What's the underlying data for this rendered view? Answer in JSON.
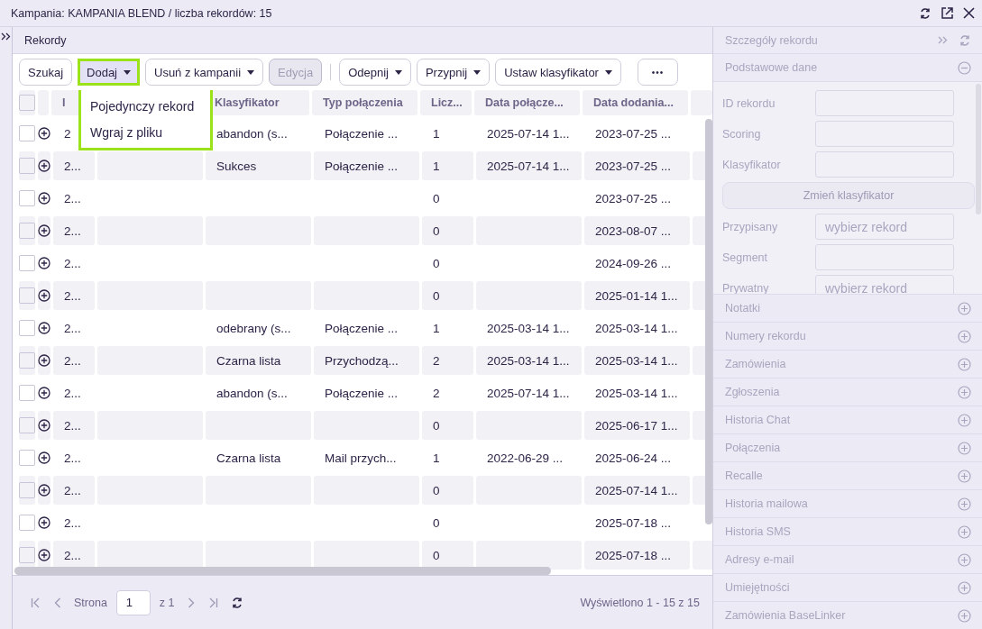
{
  "window": {
    "title": "Kampania: KAMPANIA BLEND / liczba rekordów: 15"
  },
  "panel_title": "Rekordy",
  "toolbar": [
    {
      "kind": "button",
      "label": "Szukaj",
      "dropdown": false,
      "disabled": false,
      "selected": false
    },
    {
      "kind": "button",
      "label": "Dodaj",
      "dropdown": true,
      "disabled": false,
      "selected": true
    },
    {
      "kind": "button",
      "label": "Usuń z kampanii",
      "dropdown": true,
      "disabled": false,
      "selected": false
    },
    {
      "kind": "button",
      "label": "Edycja",
      "dropdown": false,
      "disabled": true,
      "selected": false
    },
    {
      "kind": "separator"
    },
    {
      "kind": "button",
      "label": "Odepnij",
      "dropdown": true,
      "disabled": false,
      "selected": false
    },
    {
      "kind": "button",
      "label": "Przypnij",
      "dropdown": true,
      "disabled": false,
      "selected": false
    },
    {
      "kind": "button",
      "label": "Ustaw klasyfikator",
      "dropdown": true,
      "disabled": false,
      "selected": false
    },
    {
      "kind": "more",
      "label": "•••"
    }
  ],
  "dropdown_menu": [
    "Pojedynczy rekord",
    "Wgraj z pliku"
  ],
  "table": {
    "header_checked": false,
    "columns": [
      "I",
      null,
      "Klasyfikator",
      "Typ połączenia",
      "Licz...",
      "Data połącze...",
      "Data dodania...",
      null
    ],
    "rows": [
      {
        "checked": false,
        "cells": [
          "2",
          null,
          "abandon (s...",
          "Połączenie ...",
          "1",
          "2025-07-14 1...",
          "2023-07-25 ...",
          null
        ]
      },
      {
        "checked": false,
        "cells": [
          "2...",
          null,
          "Sukces",
          "Połączenie ...",
          "1",
          "2025-07-14 1...",
          "2023-07-25 ...",
          null
        ]
      },
      {
        "checked": false,
        "cells": [
          "2...",
          null,
          null,
          null,
          "0",
          null,
          "2023-07-25 ...",
          null
        ]
      },
      {
        "checked": false,
        "cells": [
          "2...",
          null,
          null,
          null,
          "0",
          null,
          "2023-08-07 ...",
          null
        ]
      },
      {
        "checked": false,
        "cells": [
          "2...",
          null,
          null,
          null,
          "0",
          null,
          "2024-09-26 ...",
          null
        ]
      },
      {
        "checked": false,
        "cells": [
          "2...",
          null,
          null,
          null,
          "0",
          null,
          "2025-01-14 1...",
          null
        ]
      },
      {
        "checked": false,
        "cells": [
          "2...",
          null,
          "odebrany (s...",
          "Połączenie ...",
          "1",
          "2025-03-14 1...",
          "2025-03-14 1...",
          null
        ]
      },
      {
        "checked": false,
        "cells": [
          "2...",
          null,
          "Czarna lista",
          "Przychodzą...",
          "2",
          "2025-03-14 1...",
          "2025-03-14 1...",
          null
        ]
      },
      {
        "checked": false,
        "cells": [
          "2...",
          null,
          "abandon (s...",
          "Połączenie ...",
          "2",
          "2025-07-14 1...",
          "2025-03-14 1...",
          null
        ]
      },
      {
        "checked": false,
        "cells": [
          "2...",
          null,
          null,
          null,
          "0",
          null,
          "2025-06-17 1...",
          null
        ]
      },
      {
        "checked": false,
        "cells": [
          "2...",
          null,
          "Czarna lista",
          "Mail przych...",
          "1",
          "2022-06-29 ...",
          "2025-06-24 ...",
          null
        ]
      },
      {
        "checked": false,
        "cells": [
          "2...",
          null,
          null,
          null,
          "0",
          null,
          "2025-07-14 1...",
          null
        ]
      },
      {
        "checked": false,
        "cells": [
          "2...",
          null,
          null,
          null,
          "0",
          null,
          "2025-07-18 ...",
          null
        ]
      },
      {
        "checked": false,
        "cells": [
          "2...",
          null,
          null,
          null,
          "0",
          null,
          "2025-07-18 ...",
          null
        ]
      }
    ]
  },
  "pagination": {
    "page_label": "Strona",
    "page": "1",
    "of": "z 1",
    "summary": "Wyświetlono 1 - 15 z 15"
  },
  "details": {
    "title": "Szczegóły rekordu",
    "sections": [
      {
        "title": "Podstawowe dane",
        "expanded": true,
        "fields": [
          {
            "kind": "input",
            "label": "ID rekordu"
          },
          {
            "kind": "input",
            "label": "Scoring"
          },
          {
            "kind": "input",
            "label": "Klasyfikator"
          },
          {
            "kind": "button",
            "label": "Zmień klasyfikator"
          },
          {
            "kind": "input",
            "label": "Przypisany",
            "placeholder": "wybierz rekord"
          },
          {
            "kind": "input",
            "label": "Segment"
          },
          {
            "kind": "input",
            "label": "Prywatny",
            "placeholder": "wybierz rekord"
          }
        ]
      },
      {
        "title": "Notatki",
        "expanded": false
      },
      {
        "title": "Numery rekordu",
        "expanded": false
      },
      {
        "title": "Zamówienia",
        "expanded": false
      },
      {
        "title": "Zgłoszenia",
        "expanded": false
      },
      {
        "title": "Historia Chat",
        "expanded": false
      },
      {
        "title": "Połączenia",
        "expanded": false
      },
      {
        "title": "Recalle",
        "expanded": false
      },
      {
        "title": "Historia mailowa",
        "expanded": false
      },
      {
        "title": "Historia SMS",
        "expanded": false
      },
      {
        "title": "Adresy e-mail",
        "expanded": false
      },
      {
        "title": "Umiejętności",
        "expanded": false
      },
      {
        "title": "Zamówienia BaseLinker",
        "expanded": false
      }
    ]
  }
}
